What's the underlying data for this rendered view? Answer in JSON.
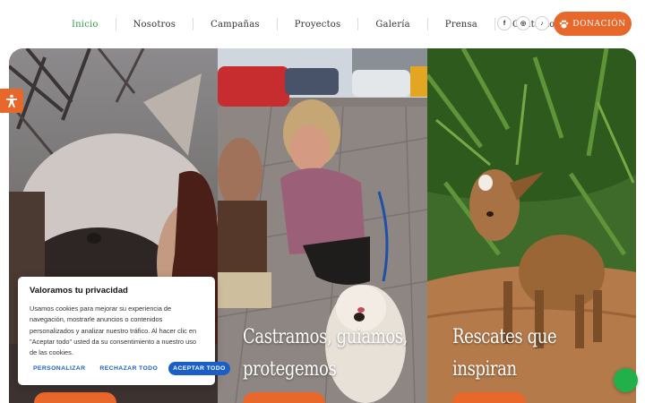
{
  "nav": {
    "items": [
      {
        "label": "Inicio",
        "active": true
      },
      {
        "label": "Nosotros"
      },
      {
        "label": "Campañas"
      },
      {
        "label": "Proyectos"
      },
      {
        "label": "Galería"
      },
      {
        "label": "Prensa"
      },
      {
        "label": "Contacto"
      }
    ]
  },
  "socials": [
    {
      "label": "f",
      "icon": "facebook-icon"
    },
    {
      "label": "◎",
      "icon": "instagram-icon"
    },
    {
      "label": "♪",
      "icon": "tiktok-icon"
    }
  ],
  "donate": {
    "label": "DONACIÓN",
    "icon": "paw-icon"
  },
  "panels": [
    {
      "title": "",
      "image": "donkey and woman"
    },
    {
      "title_line1": "Castramos, guiamos,",
      "title_line2": "protegemos"
    },
    {
      "title_line1": "Rescates que",
      "title_line2": "inspiran"
    }
  ],
  "cookie": {
    "title": "Valoramos tu privacidad",
    "text": "Usamos cookies para mejorar su experiencia de navegación, mostrarle anuncios o contenidos personalizados y analizar nuestro tráfico. Al hacer clic en \"Aceptar todo\" usted da su consentimiento a nuestro uso de las cookies.",
    "customize": "PERSONALIZAR",
    "reject": "RECHAZAR TODO",
    "accept": "ACEPTAR TODO"
  },
  "colors": {
    "accent": "#e8672a",
    "active_nav": "#2f9e4a",
    "cookie_link": "#1a5fc8",
    "chat": "#22b04b"
  }
}
